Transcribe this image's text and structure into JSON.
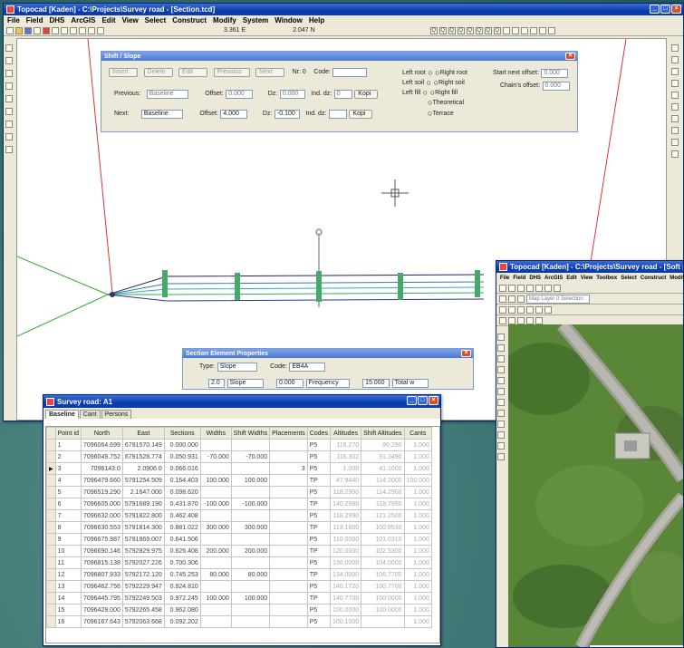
{
  "main_window": {
    "title": "Topocad [Kaden] - C:\\Projects\\Survey road - [Section.tcd]",
    "menu": [
      "File",
      "Field",
      "DHS",
      "ArcGIS",
      "Edit",
      "View",
      "Select",
      "Construct",
      "Modify",
      "System",
      "Window",
      "Help"
    ],
    "coord_x": "3.361  E",
    "coord_y": "2.047  N"
  },
  "section_dialog": {
    "title": "Shift / Slope",
    "buttons_top": [
      "Insert",
      "Delete",
      "Edit",
      "Previous",
      "Next"
    ],
    "no_label": "Nr: 0",
    "code_label": "Code:",
    "previous_label": "Previous:",
    "previous_value": "Baseline",
    "offset_label": "Offset:",
    "offset_value": "0.000",
    "dz_label": "Dz:",
    "dz_value": "0.000",
    "ind_label": "Ind. dz:",
    "ind_value": "0",
    "copy_label": "Kopi",
    "next_label": "Next:",
    "next_value": "Baseline",
    "offset2_value": "4.000",
    "dz2_label": "Dz:",
    "dz2_value": "-0.100",
    "ind2_label": "Ind. dz:",
    "kopi_label": "Kopi",
    "left_options": [
      "Left root",
      "Left soil",
      "Left fill"
    ],
    "right_options": [
      "Right root",
      "Right soil",
      "Right fill"
    ],
    "extra_options": [
      "Theoretical",
      "Terrace"
    ],
    "start_label": "Start next offset:",
    "start_value": "0.000",
    "chain_label": "Chain's offset:",
    "chain_value": "0.000"
  },
  "properties_dialog": {
    "title": "Section Element Properties",
    "type_label": "Type:",
    "type_value": "Slope",
    "code_label": "Code:",
    "code_value": "EB4A",
    "slope_label": "Slope:",
    "slope_value": "2.0",
    "slope_unit": "Slope",
    "dz_value": "0.000",
    "freq_value": "Frequency",
    "l_value": "15.000",
    "val_value": "Total w"
  },
  "table_window": {
    "title": "Survey road: A1",
    "tabs": [
      "Baseline",
      "Cant",
      "Persons"
    ],
    "headers": [
      "Point id",
      "North",
      "East",
      "Sections",
      "Widths",
      "Shift Widths",
      "Placements",
      "Codes",
      "Altitudes",
      "Shift Altitudes",
      "Cants"
    ],
    "rows": [
      [
        "1",
        "7096064.699",
        "6791570.149",
        "0.000.000",
        "",
        "",
        "",
        "P5",
        "116.270",
        "90.290",
        "1.000"
      ],
      [
        "2",
        "7096049.752",
        "6791528.774",
        "0.050.931",
        "-70.000",
        "-70.000",
        "",
        "P5",
        "116.302",
        "91.3490",
        "1.000"
      ],
      [
        "3",
        "7096143.0",
        "2.0906.0",
        "0.066.016",
        "",
        "",
        "3",
        "P5",
        "1.000",
        "41.1000",
        "1.000"
      ],
      [
        "4",
        "7096479.660",
        "5791254.509",
        "0.164.403",
        "100.000",
        "100.000",
        "",
        "TP",
        "47.9440",
        "114.2000",
        "100.000"
      ],
      [
        "5",
        "7096519.290",
        "2.1647.000",
        "0.098.620",
        "",
        "",
        "",
        "P5",
        "118.2900",
        "114.2900",
        "1.000"
      ],
      [
        "6",
        "7096605.000",
        "5791689.190",
        "0.431.870",
        "-100.000",
        "-100.000",
        "",
        "TP",
        "140.2990",
        "118.7950",
        "1.000"
      ],
      [
        "7",
        "7096632.000",
        "5791822.800",
        "0.462.408",
        "",
        "",
        "",
        "P5",
        "118.2990",
        "121.2500",
        "1.000"
      ],
      [
        "8",
        "7096630.553",
        "5791814.300",
        "0.881.022",
        "300.000",
        "300.000",
        "",
        "TP",
        "113.1800",
        "100.8530",
        "1.000"
      ],
      [
        "9",
        "7096675.987",
        "5791869.007",
        "0.641.506",
        "",
        "",
        "",
        "P5",
        "110.0000",
        "101.0310",
        "1.000"
      ],
      [
        "10",
        "7096690.146",
        "5792829.975",
        "0.626.408",
        "200.000",
        "200.000",
        "",
        "TP",
        "120.0000",
        "102.5300",
        "1.000"
      ],
      [
        "11",
        "7096815.138",
        "5792027.226",
        "0.700.306",
        "",
        "",
        "",
        "P5",
        "130.0000",
        "104.0000",
        "1.000"
      ],
      [
        "12",
        "7096807.933",
        "5792172.120",
        "0.745.253",
        "80.000",
        "80.000",
        "",
        "TP",
        "134.0000",
        "106.7700",
        "1.000"
      ],
      [
        "13",
        "7096462.756",
        "5792229.947",
        "0.924.810",
        "",
        "",
        "",
        "P5",
        "140.1720",
        "100.7700",
        "1.000"
      ],
      [
        "14",
        "7096445.795",
        "5792249.503",
        "0.972.245",
        "100.000",
        "100.000",
        "",
        "TP",
        "140.7700",
        "100.0000",
        "1.000"
      ],
      [
        "15",
        "7096429.000",
        "5792265.458",
        "0.962.080",
        "",
        "",
        "",
        "P5",
        "100.0000",
        "100.0000",
        "1.000"
      ],
      [
        "16",
        "7096167.643",
        "5792063.668",
        "0.092.202",
        "",
        "",
        "",
        "P5",
        "100.1000",
        "",
        "1.000"
      ]
    ]
  },
  "map_window": {
    "title": "Topocad [Kaden] - C:\\Projects\\Survey road - [Soft points.tcd (Level.tcd)]",
    "menu": [
      "File",
      "Field",
      "DHS",
      "ArcGIS",
      "Edit",
      "View",
      "Toolbox",
      "Select",
      "Construct",
      "Modify"
    ],
    "layer_field": "Map Layer 0 Selection"
  }
}
